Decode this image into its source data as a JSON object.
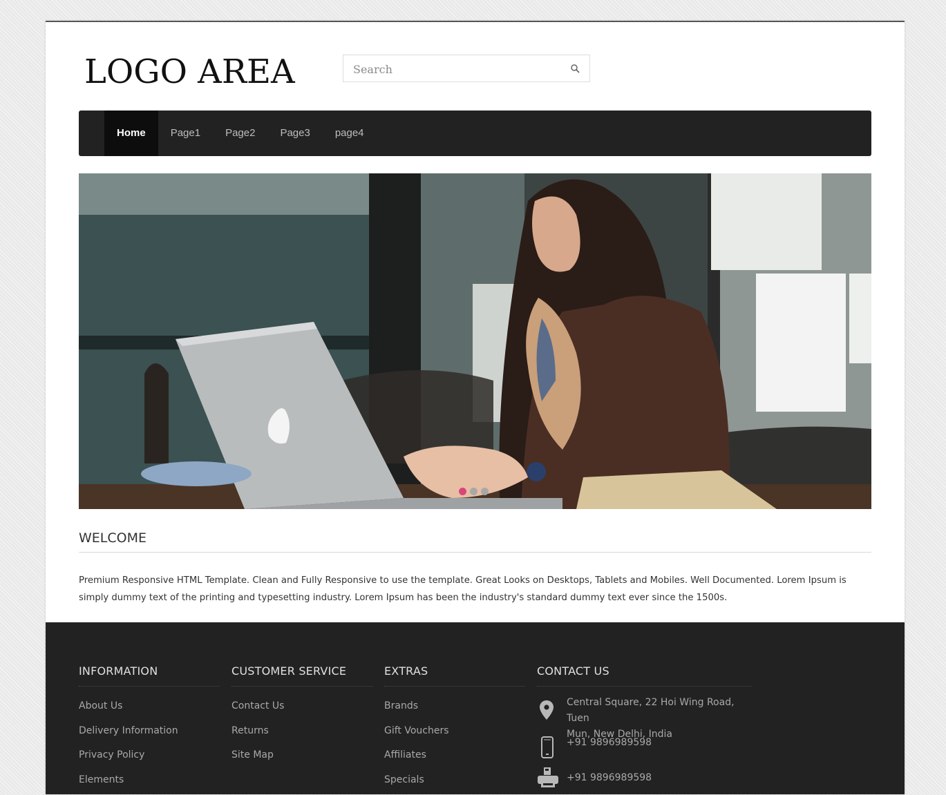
{
  "logo": "LOGO AREA",
  "search": {
    "placeholder": "Search"
  },
  "nav": {
    "items": [
      "Home",
      "Page1",
      "Page2",
      "Page3",
      "page4"
    ],
    "active": "Home"
  },
  "slider": {
    "dots": 3,
    "active_dot": 1
  },
  "welcome": {
    "title": "WELCOME",
    "text": "Premium Responsive HTML Template. Clean and Fully Responsive to use the template. Great Looks on Desktops, Tablets and Mobiles. Well Documented. Lorem Ipsum is simply dummy text of the printing and typesetting industry. Lorem Ipsum has been the industry's standard dummy text ever since the 1500s."
  },
  "footer": {
    "information": {
      "title": "INFORMATION",
      "links": [
        "About Us",
        "Delivery Information",
        "Privacy Policy",
        "Elements"
      ]
    },
    "customer_service": {
      "title": "CUSTOMER SERVICE",
      "links": [
        "Contact Us",
        "Returns",
        "Site Map"
      ]
    },
    "extras": {
      "title": "EXTRAS",
      "links": [
        "Brands",
        "Gift Vouchers",
        "Affiliates",
        "Specials"
      ]
    },
    "contact": {
      "title": "CONTACT US",
      "address_line1": "Central Square, 22 Hoi Wing Road, Tuen",
      "address_line2": "Mun, New Delhi, India",
      "phone": "+91 9896989598",
      "fax": "+91 9896989598"
    }
  },
  "colors": {
    "nav_bg": "#222222",
    "footer_bg": "#222222",
    "active_dot": "#d9467a"
  }
}
